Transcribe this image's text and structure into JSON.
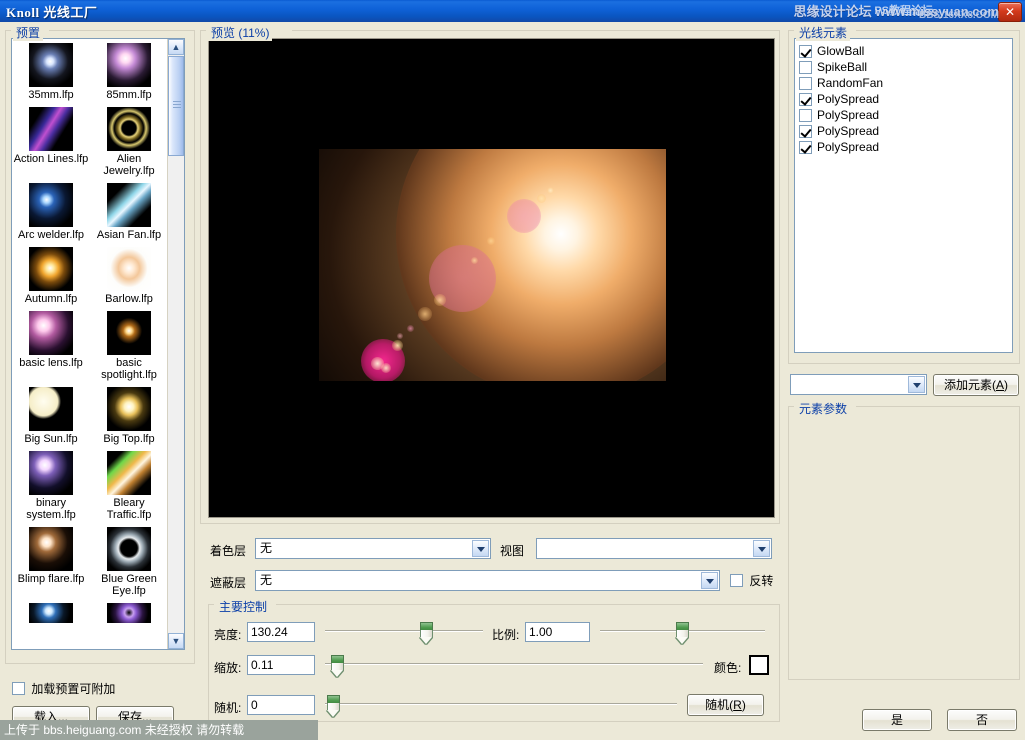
{
  "window": {
    "title": "Knoll  光线工厂",
    "close_label": "✕"
  },
  "watermarks": {
    "top_main": "思缘设计论坛 www.missyuan.com",
    "top_sub": "BBS.16XX8.COM",
    "top_alt": "PS教程论坛",
    "bottom": "上传于 bbs.heiguang.com  未经授权  请勿转载"
  },
  "preset_panel": {
    "group_label": "预置",
    "append_checkbox": {
      "label": "加载预置可附加",
      "checked": false
    },
    "load_button": "载入...",
    "save_button": "保存...",
    "items": [
      {
        "name": "35mm.lfp"
      },
      {
        "name": "85mm.lfp"
      },
      {
        "name": "Action Lines.lfp"
      },
      {
        "name": "Alien Jewelry.lfp"
      },
      {
        "name": "Arc welder.lfp"
      },
      {
        "name": "Asian Fan.lfp"
      },
      {
        "name": "Autumn.lfp"
      },
      {
        "name": "Barlow.lfp"
      },
      {
        "name": "basic lens.lfp"
      },
      {
        "name": "basic spotlight.lfp"
      },
      {
        "name": "Big Sun.lfp"
      },
      {
        "name": "Big Top.lfp"
      },
      {
        "name": "binary system.lfp"
      },
      {
        "name": "Bleary Traffic.lfp"
      },
      {
        "name": "Blimp flare.lfp"
      },
      {
        "name": "Blue Green Eye.lfp"
      }
    ]
  },
  "preview_panel": {
    "group_label": "预览 (11%)"
  },
  "elements_panel": {
    "group_label": "光线元素",
    "items": [
      {
        "label": "GlowBall",
        "checked": true
      },
      {
        "label": "SpikeBall",
        "checked": false
      },
      {
        "label": "RandomFan",
        "checked": false
      },
      {
        "label": "PolySpread",
        "checked": true
      },
      {
        "label": "PolySpread",
        "checked": false
      },
      {
        "label": "PolySpread",
        "checked": true
      },
      {
        "label": "PolySpread",
        "checked": true
      }
    ],
    "add_combo_value": "",
    "add_button": {
      "text": "添加元素(",
      "accel": "A",
      "tail": ")"
    },
    "params_group_label": "元素参数"
  },
  "controls": {
    "colorize_layer_label": "着色层",
    "colorize_layer_value": "无",
    "view_label": "视图",
    "view_value": "",
    "mask_layer_label": "遮蔽层",
    "mask_layer_value": "无",
    "invert_checkbox": {
      "label": "反转",
      "checked": false
    },
    "main_group_label": "主要控制",
    "brightness_label": "亮度:",
    "brightness_value": "130.24",
    "scale_label": "比例:",
    "scale_value": "1.00",
    "zoom_label": "缩放:",
    "zoom_value": "0.11",
    "random_label": "随机:",
    "random_value": "0",
    "color_label": "颜色:",
    "color_value": "#ffffff",
    "random_button": {
      "text": "随机(",
      "accel": "R",
      "tail": ")"
    }
  },
  "dialog_buttons": {
    "ok": "是",
    "cancel": "否"
  }
}
